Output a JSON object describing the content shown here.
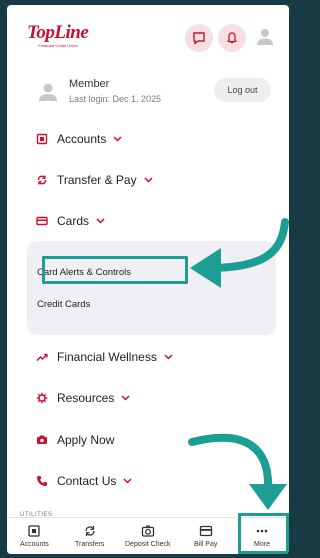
{
  "brand": {
    "logo_text": "TopLine",
    "logo_subtext": "Financial Credit Union"
  },
  "header": {
    "chat_icon": "chat-bubble-icon",
    "bell_icon": "bell-icon",
    "user_icon": "user-icon"
  },
  "member": {
    "name": "Member",
    "last_login": "Last login: Dec 1, 2025",
    "logout_label": "Log out"
  },
  "menu": {
    "accounts": "Accounts",
    "transfer_pay": "Transfer & Pay",
    "cards": "Cards",
    "cards_sub": [
      "Card Alerts & Controls",
      "Credit Cards"
    ],
    "financial_wellness": "Financial Wellness",
    "resources": "Resources",
    "apply_now": "Apply Now",
    "contact_us": "Contact Us"
  },
  "utilities_label": "UTILITIES",
  "bottom_nav": [
    {
      "label": "Accounts",
      "icon": "accounts-icon"
    },
    {
      "label": "Transfers",
      "icon": "transfers-icon"
    },
    {
      "label": "Deposit Check",
      "icon": "camera-icon"
    },
    {
      "label": "Bill Pay",
      "icon": "bill-pay-icon"
    },
    {
      "label": "More",
      "icon": "more-dots-icon"
    }
  ],
  "colors": {
    "brand_red": "#c8102e",
    "highlight_teal": "#1d9e94",
    "submenu_bg": "#f0eff3"
  }
}
